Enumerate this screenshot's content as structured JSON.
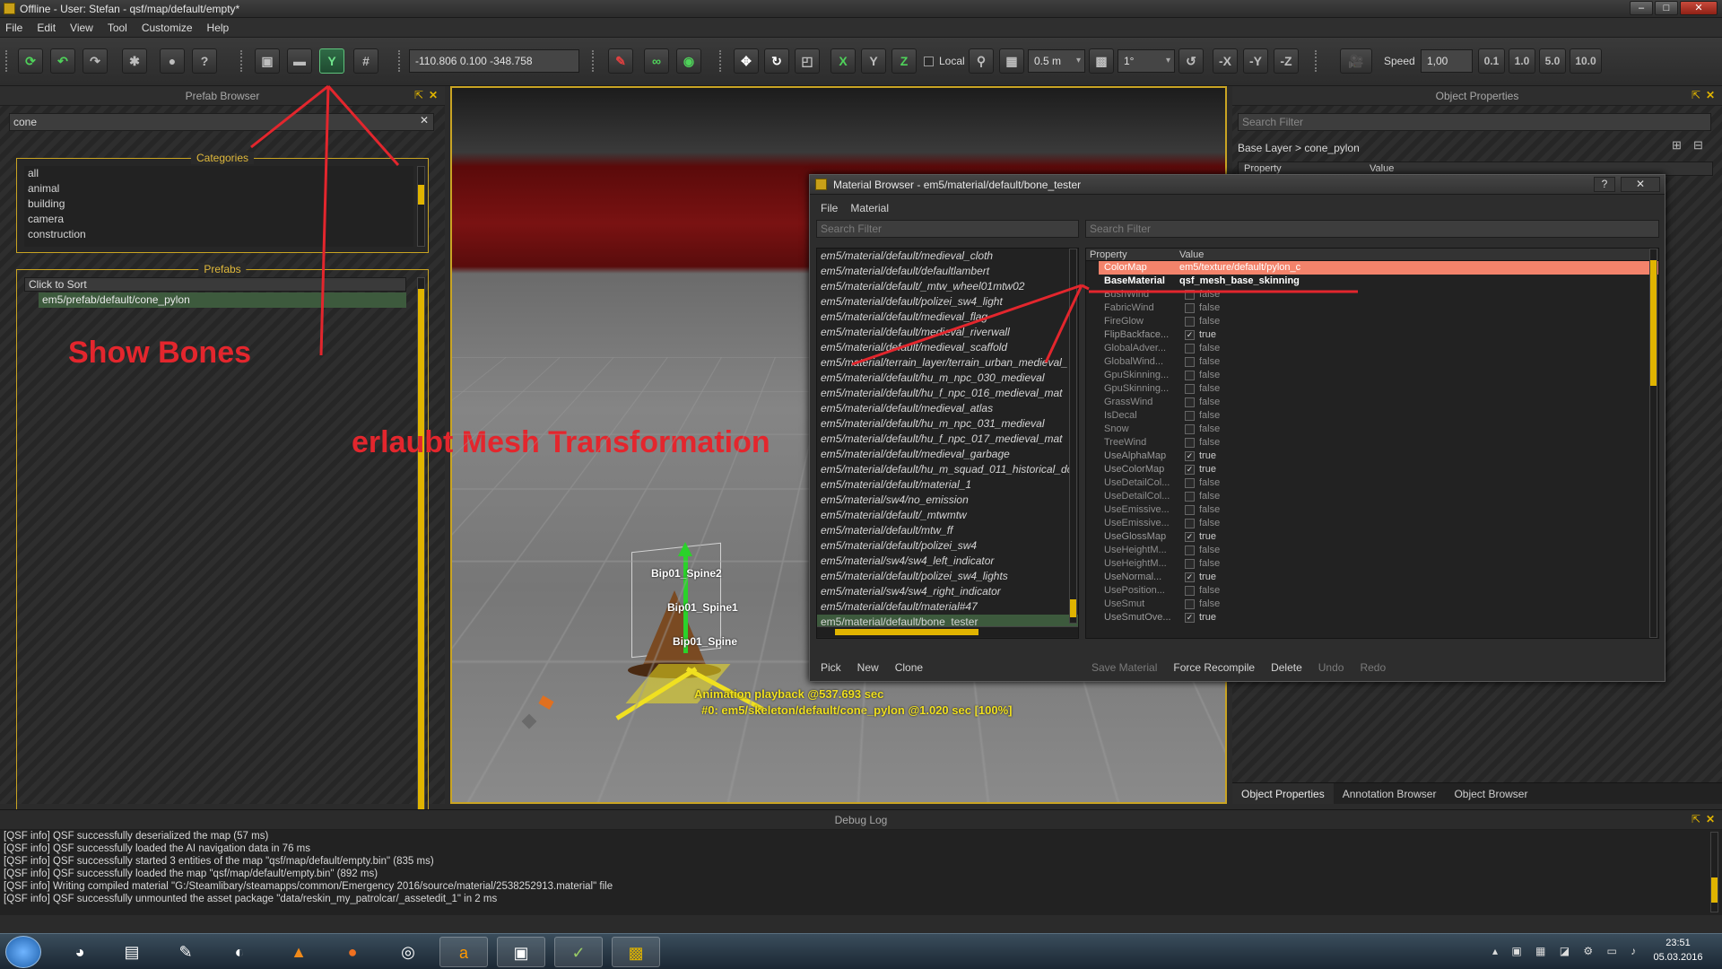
{
  "window": {
    "title": "Offline - User: Stefan - qsf/map/default/empty*",
    "controls": {
      "minimize": "–",
      "maximize": "□",
      "close": "✕"
    }
  },
  "menu": [
    "File",
    "Edit",
    "View",
    "Tool",
    "Customize",
    "Help"
  ],
  "toolbar": {
    "coords": "-110.806 0.100 -348.758",
    "axis_x": "X",
    "axis_y": "Y",
    "axis_z": "Z",
    "local_label": "Local",
    "grid_size": "0.5 m",
    "angle_snap": "1°",
    "neg_x": "-X",
    "neg_y": "-Y",
    "neg_z": "-Z",
    "speed_label": "Speed",
    "speed_value": "1,00",
    "speed_presets": [
      "0.1",
      "1.0",
      "5.0",
      "10.0"
    ]
  },
  "prefab_browser": {
    "title": "Prefab Browser",
    "search_value": "cone",
    "categories_title": "Categories",
    "categories": [
      "all",
      "animal",
      "building",
      "camera",
      "construction"
    ],
    "prefabs_title": "Prefabs",
    "sort_header": "Click to Sort",
    "prefabs": [
      "em5/prefab/default/cone_pylon"
    ]
  },
  "annotations": {
    "show_bones": "Show Bones",
    "mesh_transform": "erlaubt Mesh Transformation"
  },
  "viewport": {
    "bones": [
      "Bip01_Spine2",
      "Bip01_Spine1",
      "Bip01_Spine"
    ],
    "playback_line1": "Animation playback @537.693 sec",
    "playback_line2": "#0: em5/skeleton/default/cone_pylon @1.020 sec [100%]"
  },
  "material_browser": {
    "title": "Material Browser - em5/material/default/bone_tester",
    "help": "?",
    "close": "✕",
    "menu": [
      "File",
      "Material"
    ],
    "left_filter_placeholder": "Search Filter",
    "right_filter_placeholder": "Search Filter",
    "materials": [
      "em5/material/default/medieval_cloth",
      "em5/material/default/defaultlambert",
      "em5/material/default/_mtw_wheel01mtw02",
      "em5/material/default/polizei_sw4_light",
      "em5/material/default/medieval_flag",
      "em5/material/default/medieval_riverwall",
      "em5/material/default/medieval_scaffold",
      "em5/material/terrain_layer/terrain_urban_medieval_",
      "em5/material/default/hu_m_npc_030_medieval",
      "em5/material/default/hu_f_npc_016_medieval_mat",
      "em5/material/default/medieval_atlas",
      "em5/material/default/hu_m_npc_031_medieval",
      "em5/material/default/hu_f_npc_017_medieval_mat",
      "em5/material/default/medieval_garbage",
      "em5/material/default/hu_m_squad_011_historical_dc",
      "em5/material/default/material_1",
      "em5/material/sw4/no_emission",
      "em5/material/default/_mtwmtw",
      "em5/material/default/mtw_ff",
      "em5/material/default/polizei_sw4",
      "em5/material/sw4/sw4_left_indicator",
      "em5/material/default/polizei_sw4_lights",
      "em5/material/sw4/sw4_right_indicator",
      "em5/material/default/material#47",
      "em5/material/default/bone_tester"
    ],
    "selected_material": "em5/material/default/bone_tester",
    "prop_header": {
      "property": "Property",
      "value": "Value"
    },
    "colormap": {
      "name": "ColorMap",
      "value": "em5/texture/default/pylon_c"
    },
    "basematerial": {
      "name": "BaseMaterial",
      "value": "qsf_mesh_base_skinning"
    },
    "flags": [
      {
        "name": "BushWind",
        "value": "false"
      },
      {
        "name": "FabricWind",
        "value": "false"
      },
      {
        "name": "FireGlow",
        "value": "false"
      },
      {
        "name": "FlipBackface...",
        "value": "true"
      },
      {
        "name": "GlobalAdver...",
        "value": "false"
      },
      {
        "name": "GlobalWind...",
        "value": "false"
      },
      {
        "name": "GpuSkinning...",
        "value": "false"
      },
      {
        "name": "GpuSkinning...",
        "value": "false"
      },
      {
        "name": "GrassWind",
        "value": "false"
      },
      {
        "name": "IsDecal",
        "value": "false"
      },
      {
        "name": "Snow",
        "value": "false"
      },
      {
        "name": "TreeWind",
        "value": "false"
      },
      {
        "name": "UseAlphaMap",
        "value": "true"
      },
      {
        "name": "UseColorMap",
        "value": "true"
      },
      {
        "name": "UseDetailCol...",
        "value": "false"
      },
      {
        "name": "UseDetailCol...",
        "value": "false"
      },
      {
        "name": "UseEmissive...",
        "value": "false"
      },
      {
        "name": "UseEmissive...",
        "value": "false"
      },
      {
        "name": "UseGlossMap",
        "value": "true"
      },
      {
        "name": "UseHeightM...",
        "value": "false"
      },
      {
        "name": "UseHeightM...",
        "value": "false"
      },
      {
        "name": "UseNormal...",
        "value": "true"
      },
      {
        "name": "UsePosition...",
        "value": "false"
      },
      {
        "name": "UseSmut",
        "value": "false"
      },
      {
        "name": "UseSmutOve...",
        "value": "true"
      }
    ],
    "left_buttons": [
      "Pick",
      "New",
      "Clone"
    ],
    "right_buttons": [
      "Save Material",
      "Force Recompile",
      "Delete",
      "Undo",
      "Redo"
    ]
  },
  "object_properties": {
    "title": "Object Properties",
    "search_placeholder": "Search Filter",
    "breadcrumb": "Base Layer > cone_pylon",
    "col_property": "Property",
    "col_value": "Value",
    "tabs": [
      "Object Properties",
      "Annotation Browser",
      "Object Browser"
    ]
  },
  "debug_log": {
    "title": "Debug Log",
    "lines": [
      "[QSF info] QSF successfully deserialized the map (57 ms)",
      "[QSF info] QSF successfully loaded the AI navigation data in 76 ms",
      "[QSF info] QSF successfully started 3 entities of the map \"qsf/map/default/empty.bin\" (835 ms)",
      "[QSF info] QSF successfully loaded the map \"qsf/map/default/empty.bin\" (892 ms)",
      "[QSF info] Writing compiled material \"G:/Steamlibary/steamapps/common/Emergency 2016/source/material/2538252913.material\" file",
      "[QSF info] QSF successfully unmounted the asset package \"data/reskin_my_patrolcar/_assetedit_1\" in 2 ms"
    ]
  },
  "taskbar": {
    "time": "23:51",
    "date": "05.03.2016"
  },
  "colors": {
    "accent_yellow": "#c9a423",
    "annotation_red": "#e3262d",
    "selected_green": "#3d5a3d",
    "colormap_row": "#f3836b"
  }
}
